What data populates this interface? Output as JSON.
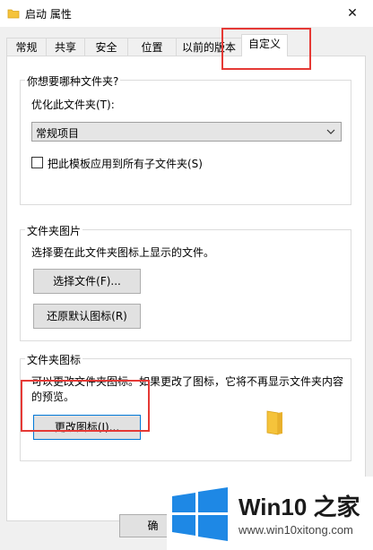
{
  "window": {
    "title": "启动 属性",
    "close_glyph": "✕"
  },
  "tabs": [
    {
      "label": "常规"
    },
    {
      "label": "共享"
    },
    {
      "label": "安全"
    },
    {
      "label": "位置"
    },
    {
      "label": "以前的版本"
    },
    {
      "label": "自定义",
      "active": true
    }
  ],
  "optimize_group": {
    "title": "你想要哪种文件夹?",
    "optimize_label": "优化此文件夹(T):",
    "template_value": "常规项目",
    "apply_checkbox_label": "把此模板应用到所有子文件夹(S)",
    "apply_checked": false
  },
  "pictures_group": {
    "title": "文件夹图片",
    "description": "选择要在此文件夹图标上显示的文件。",
    "choose_file_label": "选择文件(F)...",
    "restore_default_label": "还原默认图标(R)"
  },
  "icons_group": {
    "title": "文件夹图标",
    "description_line1": "可以更改文件夹图标。如果更改了图标，它将不再显示文件夹内容",
    "description_line2": "的预览。",
    "change_icon_label": "更改图标(I)..."
  },
  "footer": {
    "ok_label": "确"
  },
  "watermark": {
    "title": "Win10 之家",
    "url": "www.win10xitong.com"
  },
  "colors": {
    "highlight_box": "#e53935",
    "win_logo_blue": "#1e88e5",
    "folder_yellow": "#f5c33b"
  }
}
